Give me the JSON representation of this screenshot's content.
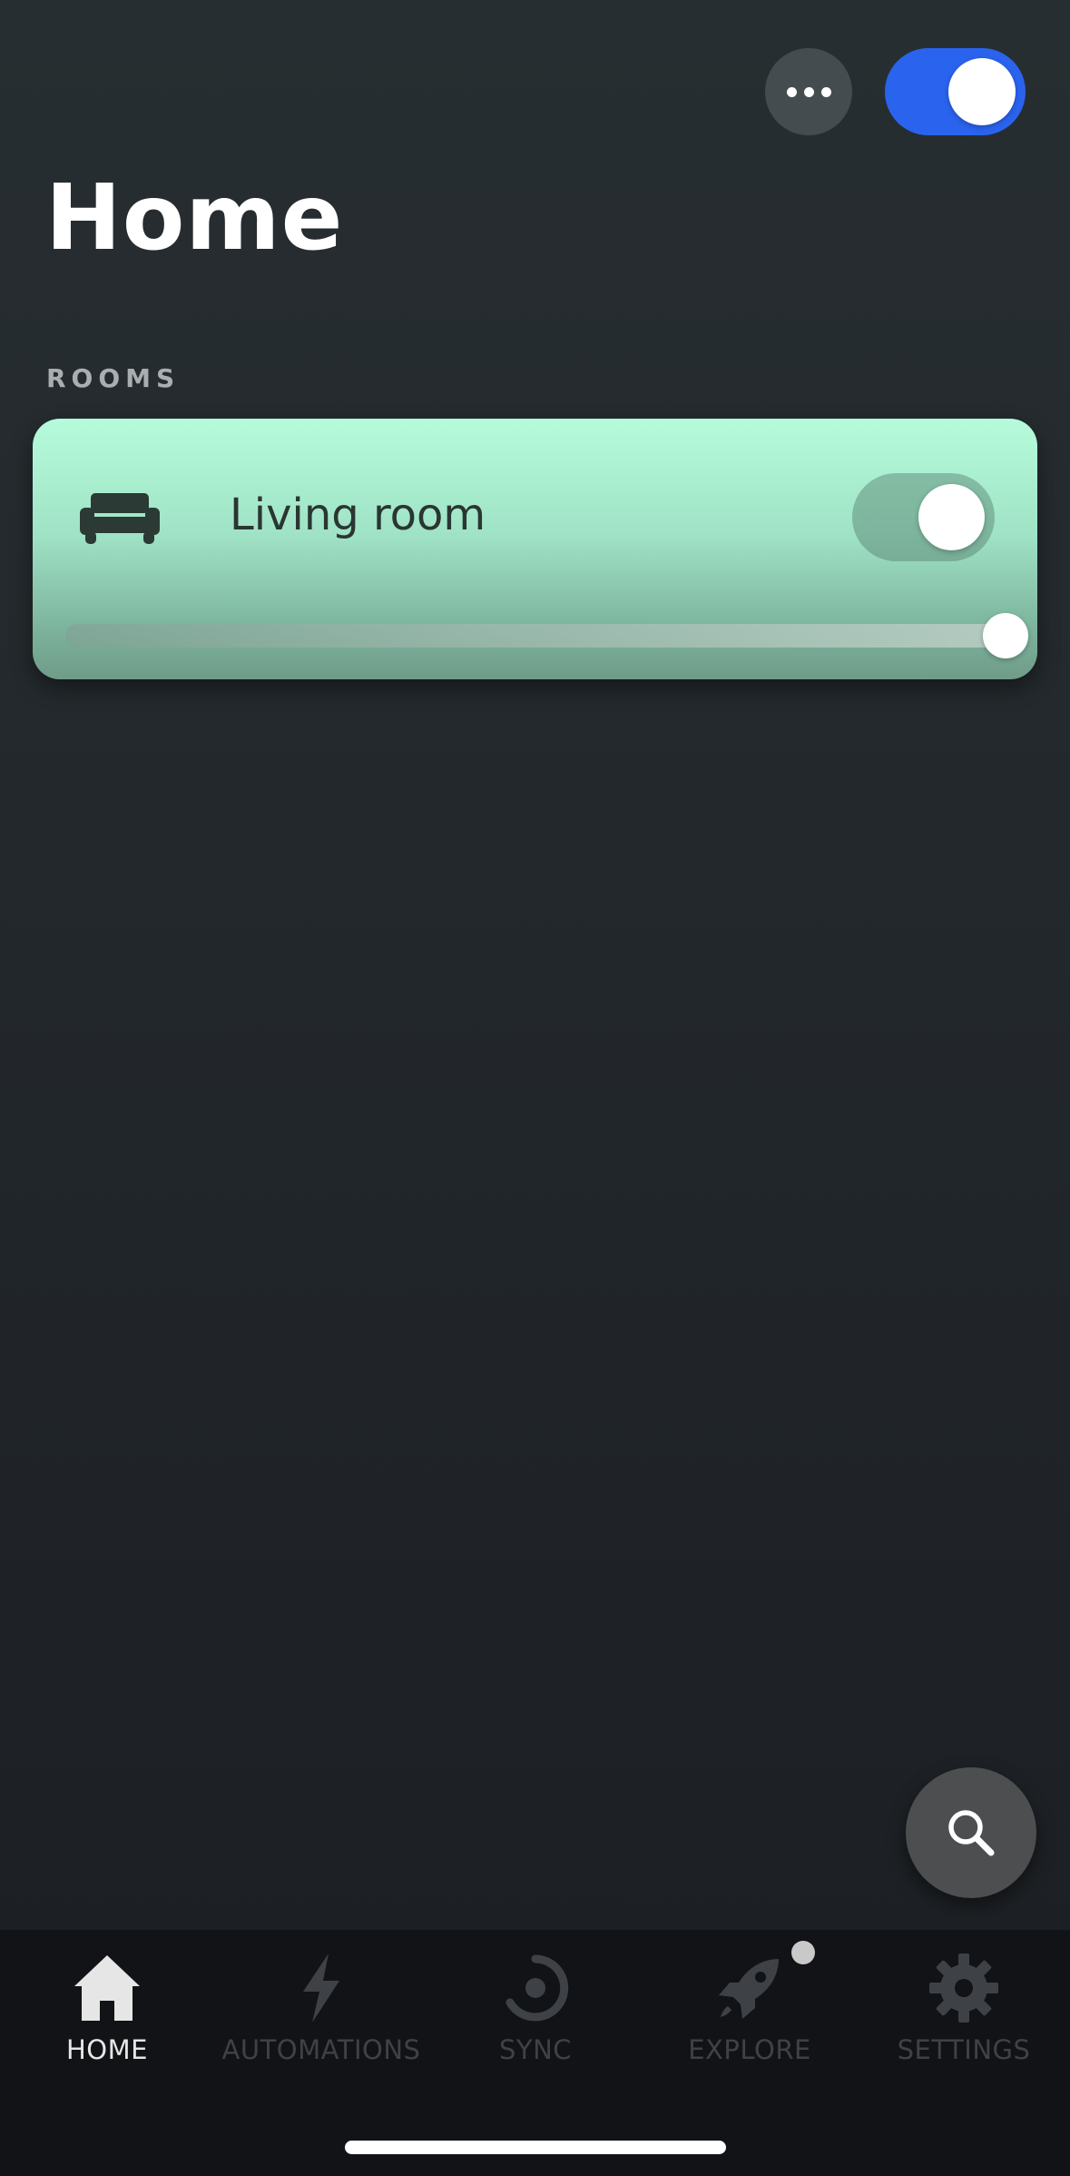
{
  "header": {
    "title": "Home",
    "more_icon": "more-horizontal-icon",
    "master_toggle_on": true
  },
  "rooms": {
    "section_label": "ROOMS",
    "items": [
      {
        "name": "Living room",
        "icon": "sofa-icon",
        "toggle_on": true,
        "brightness_percent": 100
      }
    ]
  },
  "search": {
    "icon": "search-icon"
  },
  "tabs": [
    {
      "label": "HOME",
      "icon": "home-icon",
      "active": true
    },
    {
      "label": "AUTOMATIONS",
      "icon": "lightning-icon",
      "active": false
    },
    {
      "label": "SYNC",
      "icon": "sync-icon",
      "active": false
    },
    {
      "label": "EXPLORE",
      "icon": "rocket-icon",
      "active": false,
      "badge": true
    },
    {
      "label": "SETTINGS",
      "icon": "gear-icon",
      "active": false
    }
  ],
  "colors": {
    "accent_blue": "#2a63ee",
    "room_card": "#b6fcdc",
    "tab_active": "#e6e6e6",
    "tab_inactive": "#3e4246"
  }
}
